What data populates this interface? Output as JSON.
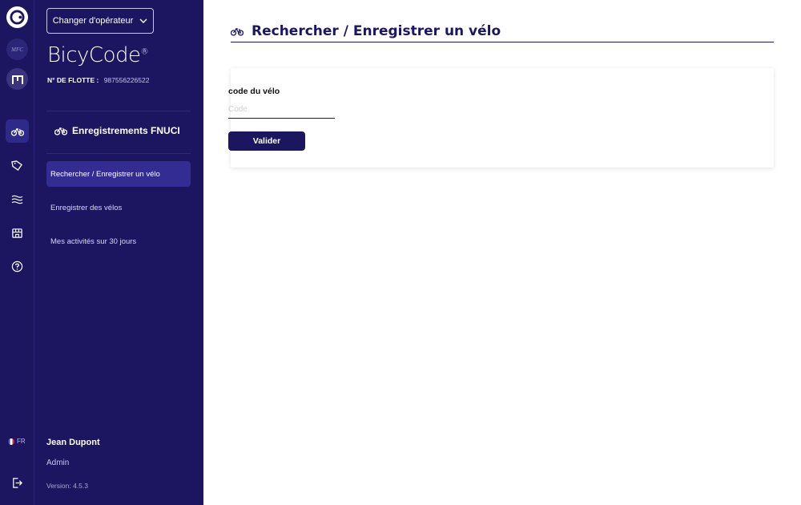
{
  "operator_button": {
    "label": "Changer d'opérateur"
  },
  "brand": {
    "logo_text": "BicyCode",
    "logo_mark": "®"
  },
  "fleet": {
    "label": "N° DE FLOTTE :",
    "number": "987556226522"
  },
  "org_logos": [
    "MFC"
  ],
  "sidebar": {
    "section_title": "Enregistrements FNUCI",
    "items": [
      {
        "label": "Rechercher / Enregistrer un vélo",
        "active": true
      },
      {
        "label": "Enregistrer des vélos",
        "active": false
      },
      {
        "label": "Mes activités sur 30 jours",
        "active": false
      }
    ]
  },
  "language": {
    "code": "FR"
  },
  "user": {
    "name": "Jean Dupont",
    "role": "Admin",
    "version": "Version: 4.5.3"
  },
  "page": {
    "title": "Rechercher / Enregistrer un vélo"
  },
  "form": {
    "field_label": "code du vélo",
    "placeholder": "Code",
    "value": "",
    "submit_label": "Valider"
  },
  "colors": {
    "primary": "#1c1660",
    "active_nav": "#332d93",
    "accent_white": "#ffffff"
  }
}
